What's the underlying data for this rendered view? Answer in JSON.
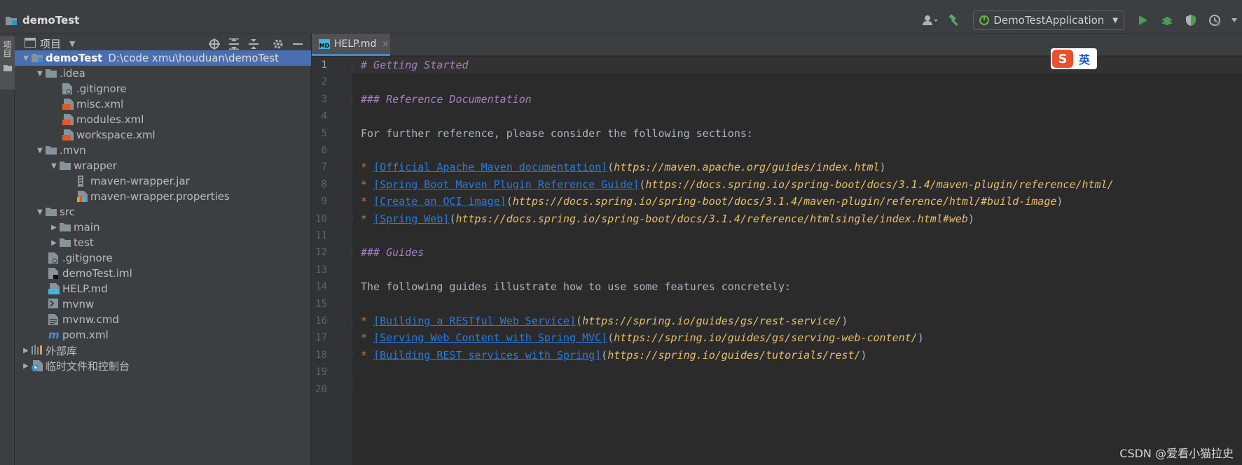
{
  "window": {
    "project_title": "demoTest"
  },
  "toolbar": {
    "run_config": "DemoTestApplication"
  },
  "sidebar": {
    "vertical_tab_label": "项目"
  },
  "project_panel": {
    "title": "项目",
    "tree": [
      {
        "label": "demoTest",
        "path": "D:\\code xmu\\houduan\\demoTest",
        "icon": "module-folder-icon",
        "expanded": true,
        "selected": true
      },
      {
        "label": ".idea",
        "icon": "folder-icon",
        "expanded": true
      },
      {
        "label": ".gitignore",
        "icon": "gitignore-file-icon"
      },
      {
        "label": "misc.xml",
        "icon": "xml-file-icon"
      },
      {
        "label": "modules.xml",
        "icon": "xml-file-icon"
      },
      {
        "label": "workspace.xml",
        "icon": "xml-file-icon"
      },
      {
        "label": ".mvn",
        "icon": "folder-icon",
        "expanded": true
      },
      {
        "label": "wrapper",
        "icon": "folder-icon",
        "expanded": true
      },
      {
        "label": "maven-wrapper.jar",
        "icon": "jar-file-icon"
      },
      {
        "label": "maven-wrapper.properties",
        "icon": "properties-file-icon"
      },
      {
        "label": "src",
        "icon": "folder-icon",
        "expanded": true
      },
      {
        "label": "main",
        "icon": "folder-icon",
        "expanded": false
      },
      {
        "label": "test",
        "icon": "folder-icon",
        "expanded": false
      },
      {
        "label": ".gitignore",
        "icon": "gitignore-file-icon"
      },
      {
        "label": "demoTest.iml",
        "icon": "iml-file-icon"
      },
      {
        "label": "HELP.md",
        "icon": "markdown-file-icon"
      },
      {
        "label": "mvnw",
        "icon": "shell-file-icon"
      },
      {
        "label": "mvnw.cmd",
        "icon": "cmd-file-icon"
      },
      {
        "label": "pom.xml",
        "icon": "maven-file-icon"
      },
      {
        "label": "外部库",
        "icon": "library-icon",
        "expanded": false
      },
      {
        "label": "临时文件和控制台",
        "icon": "scratches-icon",
        "expanded": false
      }
    ]
  },
  "editor": {
    "tab_label": "HELP.md",
    "tab_icon_text": "MD",
    "line_numbers": [
      "1",
      "2",
      "3",
      "4",
      "5",
      "6",
      "7",
      "8",
      "9",
      "10",
      "11",
      "12",
      "13",
      "14",
      "15",
      "16",
      "17",
      "18",
      "19",
      "20"
    ],
    "lines": {
      "l1": "# Getting Started",
      "l3": "### Reference Documentation",
      "l5": "For further reference, please consider the following sections:",
      "l7_link": "[Official Apache Maven documentation]",
      "l7_url": "https://maven.apache.org/guides/index.html",
      "l8_link": "[Spring Boot Maven Plugin Reference Guide]",
      "l8_url": "https://docs.spring.io/spring-boot/docs/3.1.4/maven-plugin/reference/html/",
      "l9_link": "[Create an OCI image]",
      "l9_url": "https://docs.spring.io/spring-boot/docs/3.1.4/maven-plugin/reference/html/#build-image",
      "l10_link": "[Spring Web]",
      "l10_url": "https://docs.spring.io/spring-boot/docs/3.1.4/reference/htmlsingle/index.html#web",
      "l12": "### Guides",
      "l14": "The following guides illustrate how to use some features concretely:",
      "l16_link": "[Building a RESTful Web Service]",
      "l16_url": "https://spring.io/guides/gs/rest-service/",
      "l17_link": "[Serving Web Content with Spring MVC]",
      "l17_url": "https://spring.io/guides/gs/serving-web-content/",
      "l18_link": "[Building REST services with Spring]",
      "l18_url": "https://spring.io/guides/tutorials/rest/"
    }
  },
  "ime": {
    "logo": "S",
    "lang": "英"
  },
  "watermark": "CSDN @爱看小猫拉史",
  "colors": {
    "selection": "#4b6eaf",
    "header": "#a87dc5",
    "link": "#287bde",
    "url": "#e8bf6a",
    "bullet": "#cc7832"
  }
}
